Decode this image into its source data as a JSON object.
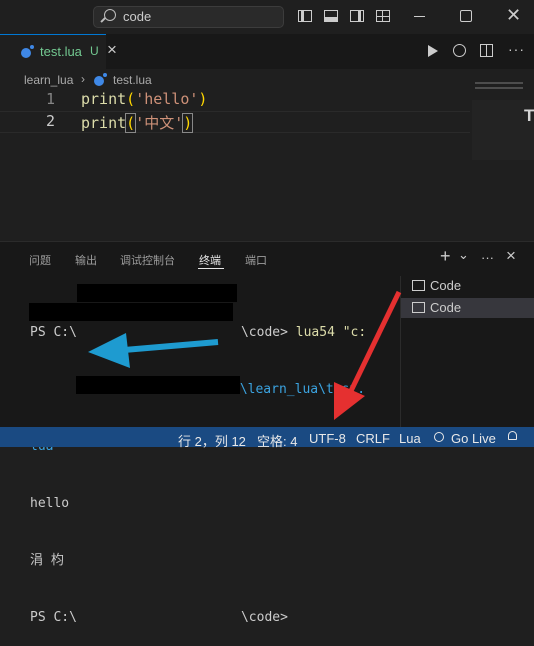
{
  "titlebar": {
    "search_text": "code"
  },
  "tab": {
    "filename": "test.lua",
    "status": "U",
    "close": "×"
  },
  "breadcrumb": {
    "folder": "learn_lua",
    "separator": "›",
    "file": "test.lua"
  },
  "editor": {
    "lines": [
      {
        "num": "1",
        "kw": "print",
        "open": "(",
        "str": "'hello'",
        "close": ")"
      },
      {
        "num": "2",
        "kw": "print",
        "open": "(",
        "str": "'中文'",
        "close": ")"
      }
    ]
  },
  "panel": {
    "tabs": [
      "问题",
      "输出",
      "调试控制台",
      "终端",
      "端口"
    ],
    "active_tab": "终端",
    "add": "+",
    "dropdown": "⌄",
    "more": "···",
    "close": "×"
  },
  "terminal": {
    "line1_prefix": "PS C:\\",
    "line1_mid": "\\code>",
    "line1_cmd": " lua54 \"c:",
    "line2_suffix": "e\\learn_lua\\test.",
    "line3": "lua\"",
    "line4": "hello",
    "line5": "涓 枃",
    "line6_prefix": "PS C:\\",
    "line6_suffix": "\\code>"
  },
  "terminals": [
    {
      "label": "Code"
    },
    {
      "label": "Code"
    }
  ],
  "statusbar": {
    "position": "行 2，列 12",
    "spaces": "空格: 4",
    "encoding": "UTF-8",
    "eol": "CRLF",
    "language": "Lua",
    "golive": "Go Live"
  },
  "colors": {
    "status_bg": "#1a4a82",
    "accent": "#0078d4",
    "arrow_blue": "#1e9bd0",
    "arrow_red": "#e53030"
  }
}
